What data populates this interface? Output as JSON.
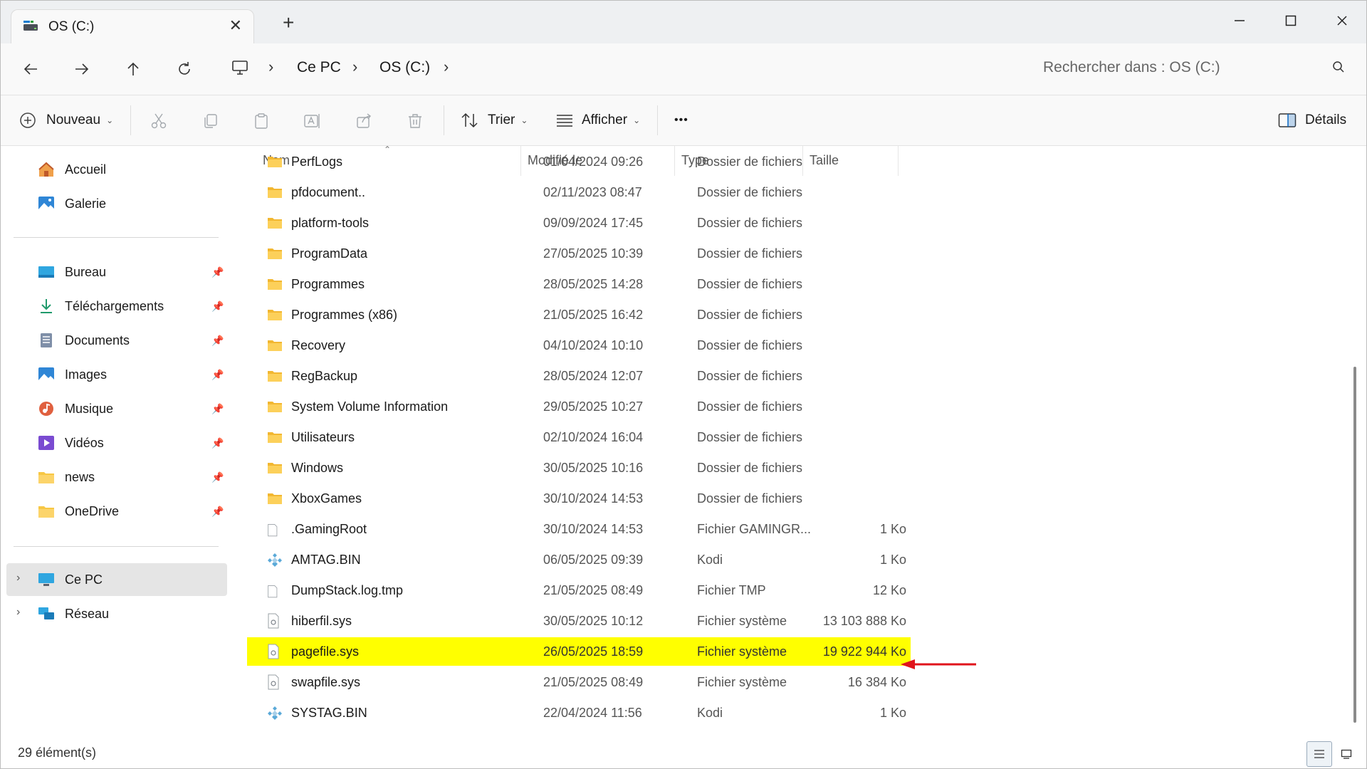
{
  "window": {
    "tab_title": "OS (C:)",
    "tab_close": "✕",
    "tab_add": "+"
  },
  "address": {
    "crumbs": [
      "Ce PC",
      "OS (C:)"
    ],
    "search_placeholder": "Rechercher dans : OS (C:)"
  },
  "toolbar": {
    "new_label": "Nouveau",
    "sort_label": "Trier",
    "view_label": "Afficher",
    "more_label": "•••",
    "details_label": "Détails"
  },
  "sidebar": {
    "top": [
      {
        "label": "Accueil",
        "icon": "home-icon"
      },
      {
        "label": "Galerie",
        "icon": "gallery-icon"
      }
    ],
    "pinned": [
      {
        "label": "Bureau",
        "icon": "desktop-icon"
      },
      {
        "label": "Téléchargements",
        "icon": "download-icon"
      },
      {
        "label": "Documents",
        "icon": "documents-icon"
      },
      {
        "label": "Images",
        "icon": "images-icon"
      },
      {
        "label": "Musique",
        "icon": "music-icon"
      },
      {
        "label": "Vidéos",
        "icon": "videos-icon"
      },
      {
        "label": "news",
        "icon": "folder-icon"
      },
      {
        "label": "OneDrive",
        "icon": "folder-icon"
      }
    ],
    "devices": [
      {
        "label": "Ce PC",
        "icon": "computer-icon"
      },
      {
        "label": "Réseau",
        "icon": "network-icon"
      }
    ]
  },
  "columns": {
    "name": "Nom",
    "modified": "Modifié le",
    "type": "Type",
    "size": "Taille"
  },
  "files": [
    {
      "name": "PerfLogs",
      "date": "01/04/2024 09:26",
      "type": "Dossier de fichiers",
      "size": "",
      "kind": "folder"
    },
    {
      "name": "pfdocument..",
      "date": "02/11/2023 08:47",
      "type": "Dossier de fichiers",
      "size": "",
      "kind": "folder"
    },
    {
      "name": "platform-tools",
      "date": "09/09/2024 17:45",
      "type": "Dossier de fichiers",
      "size": "",
      "kind": "folder"
    },
    {
      "name": "ProgramData",
      "date": "27/05/2025 10:39",
      "type": "Dossier de fichiers",
      "size": "",
      "kind": "folder"
    },
    {
      "name": "Programmes",
      "date": "28/05/2025 14:28",
      "type": "Dossier de fichiers",
      "size": "",
      "kind": "folder"
    },
    {
      "name": "Programmes (x86)",
      "date": "21/05/2025 16:42",
      "type": "Dossier de fichiers",
      "size": "",
      "kind": "folder"
    },
    {
      "name": "Recovery",
      "date": "04/10/2024 10:10",
      "type": "Dossier de fichiers",
      "size": "",
      "kind": "folder"
    },
    {
      "name": "RegBackup",
      "date": "28/05/2024 12:07",
      "type": "Dossier de fichiers",
      "size": "",
      "kind": "folder"
    },
    {
      "name": "System Volume Information",
      "date": "29/05/2025 10:27",
      "type": "Dossier de fichiers",
      "size": "",
      "kind": "folder"
    },
    {
      "name": "Utilisateurs",
      "date": "02/10/2024 16:04",
      "type": "Dossier de fichiers",
      "size": "",
      "kind": "folder"
    },
    {
      "name": "Windows",
      "date": "30/05/2025 10:16",
      "type": "Dossier de fichiers",
      "size": "",
      "kind": "folder"
    },
    {
      "name": "XboxGames",
      "date": "30/10/2024 14:53",
      "type": "Dossier de fichiers",
      "size": "",
      "kind": "folder"
    },
    {
      "name": ".GamingRoot",
      "date": "30/10/2024 14:53",
      "type": "Fichier GAMINGR...",
      "size": "1 Ko",
      "kind": "file"
    },
    {
      "name": "AMTAG.BIN",
      "date": "06/05/2025 09:39",
      "type": "Kodi",
      "size": "1 Ko",
      "kind": "kodi"
    },
    {
      "name": "DumpStack.log.tmp",
      "date": "21/05/2025 08:49",
      "type": "Fichier TMP",
      "size": "12 Ko",
      "kind": "file"
    },
    {
      "name": "hiberfil.sys",
      "date": "30/05/2025 10:12",
      "type": "Fichier système",
      "size": "13 103 888 Ko",
      "kind": "sys"
    },
    {
      "name": "pagefile.sys",
      "date": "26/05/2025 18:59",
      "type": "Fichier système",
      "size": "19 922 944 Ko",
      "kind": "sys",
      "highlight": true
    },
    {
      "name": "swapfile.sys",
      "date": "21/05/2025 08:49",
      "type": "Fichier système",
      "size": "16 384 Ko",
      "kind": "sys"
    },
    {
      "name": "SYSTAG.BIN",
      "date": "22/04/2024 11:56",
      "type": "Kodi",
      "size": "1 Ko",
      "kind": "kodi"
    }
  ],
  "status": {
    "count": "29 élément(s)"
  },
  "colors": {
    "highlight": "#ffff00",
    "arrow": "#e0141b",
    "folder": "#f7c744"
  }
}
